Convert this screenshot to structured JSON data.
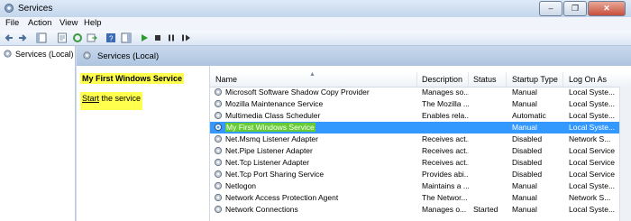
{
  "window": {
    "title": "Services"
  },
  "menu": [
    "File",
    "Action",
    "View",
    "Help"
  ],
  "tree": {
    "root_label": "Services (Local)"
  },
  "main_header": {
    "label": "Services (Local)"
  },
  "description_panel": {
    "service_title": "My First Windows Service",
    "link_start": "Start",
    "link_rest": " the service"
  },
  "columns": {
    "name": "Name",
    "description": "Description",
    "status": "Status",
    "startup_type": "Startup Type",
    "log_on_as": "Log On As"
  },
  "services": [
    {
      "name": "Microsoft Software Shadow Copy Provider",
      "description": "Manages so...",
      "status": "",
      "startup": "Manual",
      "logon": "Local Syste..."
    },
    {
      "name": "Mozilla Maintenance Service",
      "description": "The Mozilla ...",
      "status": "",
      "startup": "Manual",
      "logon": "Local Syste..."
    },
    {
      "name": "Multimedia Class Scheduler",
      "description": "Enables rela...",
      "status": "",
      "startup": "Automatic",
      "logon": "Local Syste..."
    },
    {
      "name": "My First Windows Service",
      "description": "",
      "status": "",
      "startup": "Manual",
      "logon": "Local Syste..."
    },
    {
      "name": "Net.Msmq Listener Adapter",
      "description": "Receives act...",
      "status": "",
      "startup": "Disabled",
      "logon": "Network S..."
    },
    {
      "name": "Net.Pipe Listener Adapter",
      "description": "Receives act...",
      "status": "",
      "startup": "Disabled",
      "logon": "Local Service"
    },
    {
      "name": "Net.Tcp Listener Adapter",
      "description": "Receives act...",
      "status": "",
      "startup": "Disabled",
      "logon": "Local Service"
    },
    {
      "name": "Net.Tcp Port Sharing Service",
      "description": "Provides abi...",
      "status": "",
      "startup": "Disabled",
      "logon": "Local Service"
    },
    {
      "name": "Netlogon",
      "description": "Maintains a ...",
      "status": "",
      "startup": "Manual",
      "logon": "Local Syste..."
    },
    {
      "name": "Network Access Protection Agent",
      "description": "The Networ...",
      "status": "",
      "startup": "Manual",
      "logon": "Network S..."
    },
    {
      "name": "Network Connections",
      "description": "Manages o...",
      "status": "Started",
      "startup": "Manual",
      "logon": "Local Syste..."
    }
  ],
  "selected_index": 3,
  "colors": {
    "selection": "#3399ff",
    "highlight_yellow": "#ffff4d",
    "highlight_green": "#66cc33"
  }
}
